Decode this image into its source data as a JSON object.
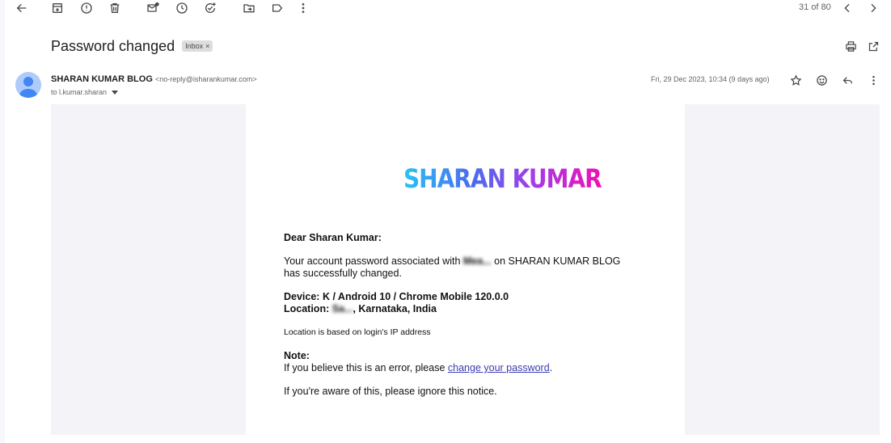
{
  "toolbar": {
    "icons": [
      "back-arrow-icon",
      "archive-icon",
      "report-spam-icon",
      "delete-icon",
      "mark-unread-icon",
      "snooze-icon",
      "add-to-tasks-icon",
      "move-to-icon",
      "label-icon",
      "more-vert-icon"
    ],
    "pager": "31 of 80"
  },
  "subject": {
    "title": "Password changed",
    "label_chip": "Inbox",
    "chip_remove": "×"
  },
  "message": {
    "sender_name": "SHARAN KUMAR BLOG",
    "sender_email": "<no-reply@isharankumar.com>",
    "to": "to l.kumar.sharan",
    "date": "Fri, 29 Dec 2023, 10:34 (9 days ago)"
  },
  "email": {
    "logo": "SHARAN KUMAR",
    "greeting": "Dear Sharan Kumar:",
    "para1_a": "Your account password associated with ",
    "para1_redacted": "Mea...",
    "para1_b": " on SHARAN KUMAR BLOG has successfully changed.",
    "device": "Device: K / Android 10 / Chrome Mobile 120.0.0",
    "location_label": "Location: ",
    "location_redacted": "Sa...",
    "location_rest": ", Karnataka, India",
    "location_note": "Location is based on login's IP address",
    "note_title": "Note:",
    "note_text_a": "If you believe this is an error, please ",
    "note_link": "change your password",
    "note_text_b": ".",
    "ignore_text": "If you're aware of this, please ignore this notice."
  },
  "colors": {
    "page_bg": "#f6f8fc",
    "email_outer_bg": "#f4f4f8",
    "link": "#3b3bb3",
    "logo_gradient": [
      "#28c3f5",
      "#4b6cf0",
      "#a33de8",
      "#f010b5"
    ]
  }
}
